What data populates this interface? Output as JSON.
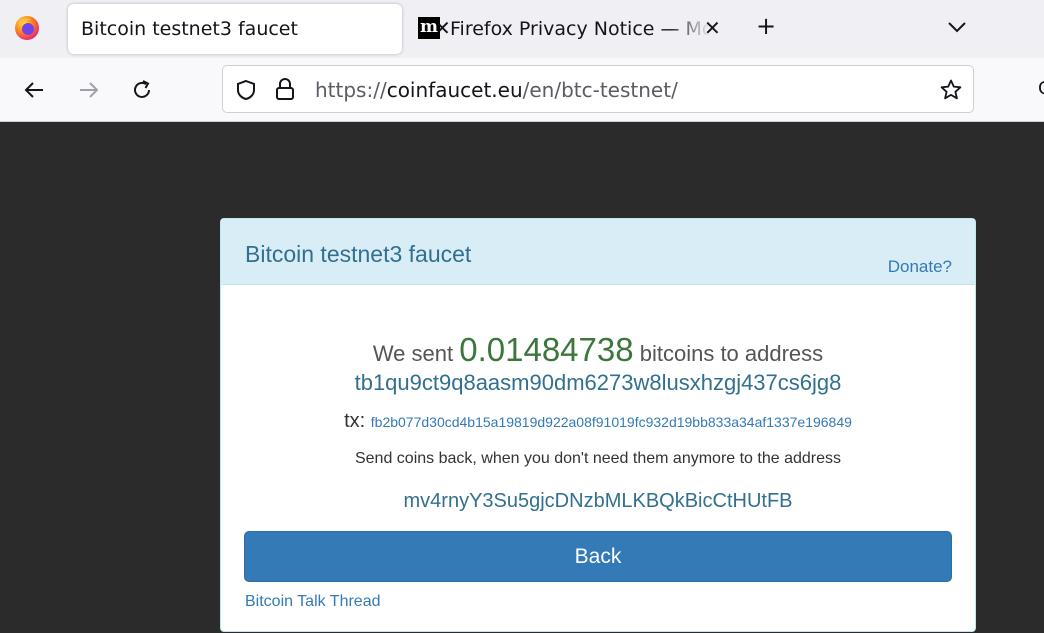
{
  "browser": {
    "tabs": [
      {
        "title": "Bitcoin testnet3 faucet",
        "active": true
      },
      {
        "title": "Firefox Privacy Notice — Mozilla",
        "favicon": "m",
        "active": false
      }
    ],
    "url": {
      "scheme": "https://",
      "host": "coinfaucet.eu",
      "path": "/en/btc-testnet/"
    },
    "icons": [
      "firefox-logo-icon",
      "close-icon",
      "plus-icon",
      "chevron-down-icon",
      "back-arrow-icon",
      "forward-arrow-icon",
      "reload-icon",
      "shield-icon",
      "lock-icon",
      "star-icon"
    ]
  },
  "page": {
    "panel_title": "Bitcoin testnet3 faucet",
    "donate_label": "Donate?",
    "sent_prefix": "We sent",
    "amount": "0.01484738",
    "sent_suffix": "bitcoins to address",
    "recipient_address": "tb1qu9ct9q8aasm90dm6273w8lusxhzgj437cs6jg8",
    "tx_label": "tx:",
    "tx_hash": "fb2b077d30cd4b15a19819d922a08f91019fc932d19bb833a34af1337e196849",
    "send_back_text": "Send coins back, when you don't need them anymore to the address",
    "return_address": "mv4rnyY3Su5gjcDNzbMLKBQkBicCtHUtFB",
    "back_label": "Back",
    "talk_thread_label": "Bitcoin Talk Thread"
  },
  "colors": {
    "panel_heading_bg": "#d9edf7",
    "amount": "#3c763d",
    "link": "#337ab7",
    "button": "#337ab7",
    "page_bg": "#2b2b2b"
  }
}
